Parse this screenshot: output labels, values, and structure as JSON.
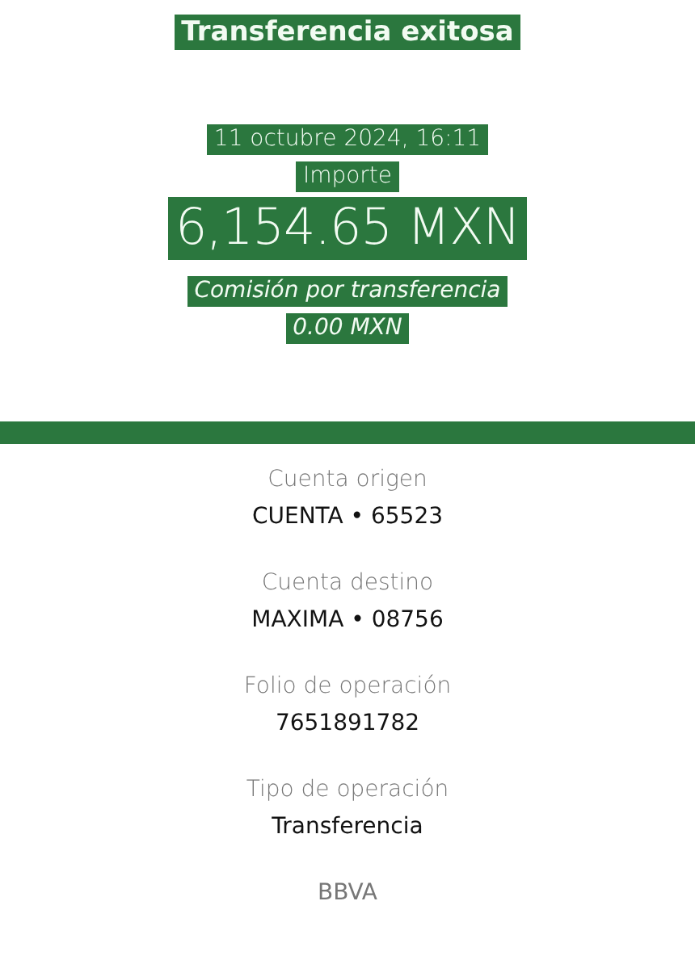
{
  "title": "Transferencia exitosa",
  "date": "11 octubre 2024, 16:11",
  "amount_label": "Importe",
  "amount": "6,154.65 MXN",
  "fee_label": "Comisión por transferencia",
  "fee": "0.00 MXN",
  "details": [
    {
      "label": "Cuenta origen",
      "value": "CUENTA • 65523"
    },
    {
      "label": "Cuenta destino",
      "value": "MAXIMA • 08756"
    },
    {
      "label": "Folio de operación",
      "value": "7651891782"
    },
    {
      "label": "Tipo de operación",
      "value": "Transferencia"
    }
  ],
  "footer": "BBVA"
}
